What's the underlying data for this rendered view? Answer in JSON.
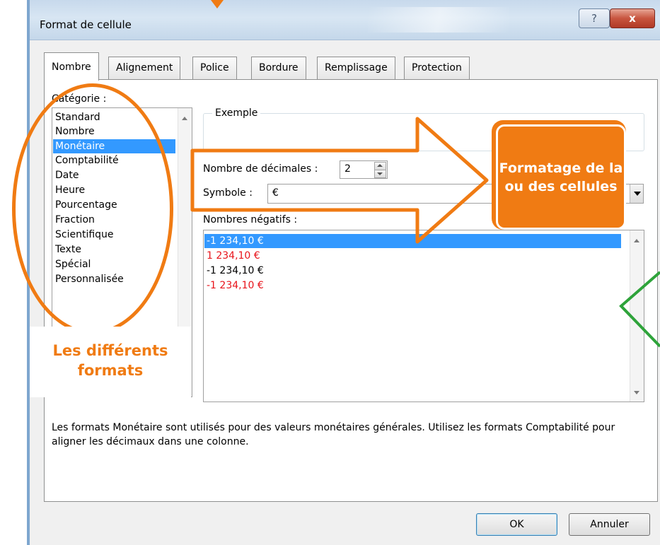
{
  "window": {
    "title": "Format de cellule",
    "help_label": "?",
    "close_label": "x"
  },
  "tabs": [
    {
      "label": "Nombre",
      "active": true
    },
    {
      "label": "Alignement",
      "active": false
    },
    {
      "label": "Police",
      "active": false
    },
    {
      "label": "Bordure",
      "active": false
    },
    {
      "label": "Remplissage",
      "active": false
    },
    {
      "label": "Protection",
      "active": false
    }
  ],
  "category": {
    "label": "Catégorie :",
    "items": [
      "Standard",
      "Nombre",
      "Monétaire",
      "Comptabilité",
      "Date",
      "Heure",
      "Pourcentage",
      "Fraction",
      "Scientifique",
      "Texte",
      "Spécial",
      "Personnalisée"
    ],
    "selected": "Monétaire"
  },
  "example": {
    "label": "Exemple"
  },
  "decimals": {
    "label": "Nombre de décimales :",
    "value": "2"
  },
  "symbol": {
    "label": "Symbole :",
    "value": "€"
  },
  "negatives": {
    "label": "Nombres négatifs :",
    "items": [
      {
        "text": "-1 234,10 €",
        "color": "#ffffff",
        "selected": true
      },
      {
        "text": "1 234,10 €",
        "color": "#e8141b",
        "selected": false
      },
      {
        "text": "-1 234,10 €",
        "color": "#000000",
        "selected": false
      },
      {
        "text": "-1 234,10 €",
        "color": "#e8141b",
        "selected": false
      }
    ]
  },
  "description": "Les formats Monétaire sont utilisés pour des valeurs monétaires générales. Utilisez les formats Comptabilité pour aligner les décimaux dans une colonne.",
  "buttons": {
    "ok": "OK",
    "cancel": "Annuler"
  },
  "annotations": {
    "categories_caption": "Les différents formats",
    "format_callout": "Formatage de la ou des cellules",
    "accent_color": "#f07b13",
    "highlight_color": "#3399ff"
  }
}
